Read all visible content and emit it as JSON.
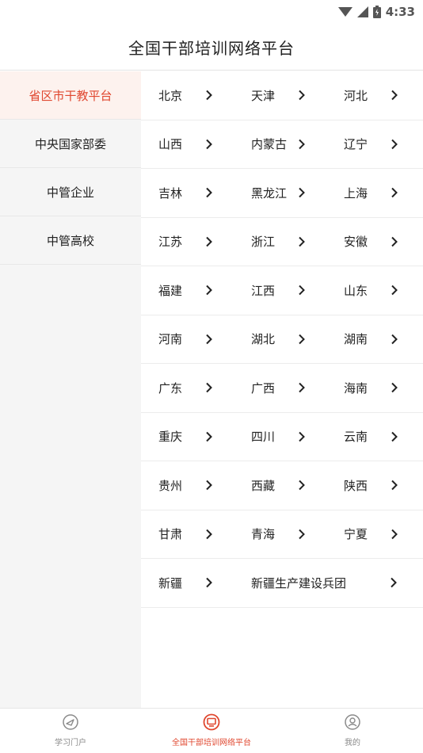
{
  "status_bar": {
    "time": "4:33"
  },
  "header": {
    "title": "全国干部培训网络平台"
  },
  "sidebar": {
    "items": [
      {
        "label": "省区市干教平台",
        "active": true
      },
      {
        "label": "中央国家部委",
        "active": false
      },
      {
        "label": "中管企业",
        "active": false
      },
      {
        "label": "中管高校",
        "active": false
      }
    ]
  },
  "regions": {
    "rows": [
      [
        "北京",
        "天津",
        "河北"
      ],
      [
        "山西",
        "内蒙古",
        "辽宁"
      ],
      [
        "吉林",
        "黑龙江",
        "上海"
      ],
      [
        "江苏",
        "浙江",
        "安徽"
      ],
      [
        "福建",
        "江西",
        "山东"
      ],
      [
        "河南",
        "湖北",
        "湖南"
      ],
      [
        "广东",
        "广西",
        "海南"
      ],
      [
        "重庆",
        "四川",
        "云南"
      ],
      [
        "贵州",
        "西藏",
        "陕西"
      ],
      [
        "甘肃",
        "青海",
        "宁夏"
      ],
      [
        "新疆",
        "新疆生产建设兵团"
      ]
    ]
  },
  "tabbar": {
    "items": [
      {
        "label": "学习门户",
        "icon": "compass-icon",
        "active": false
      },
      {
        "label": "全国干部培训网络平台",
        "icon": "monitor-icon",
        "active": true
      },
      {
        "label": "我的",
        "icon": "user-icon",
        "active": false
      }
    ]
  },
  "colors": {
    "accent": "#e0472f",
    "sidebar_bg": "#f5f5f5",
    "sidebar_active_bg": "#fdf2ee"
  }
}
